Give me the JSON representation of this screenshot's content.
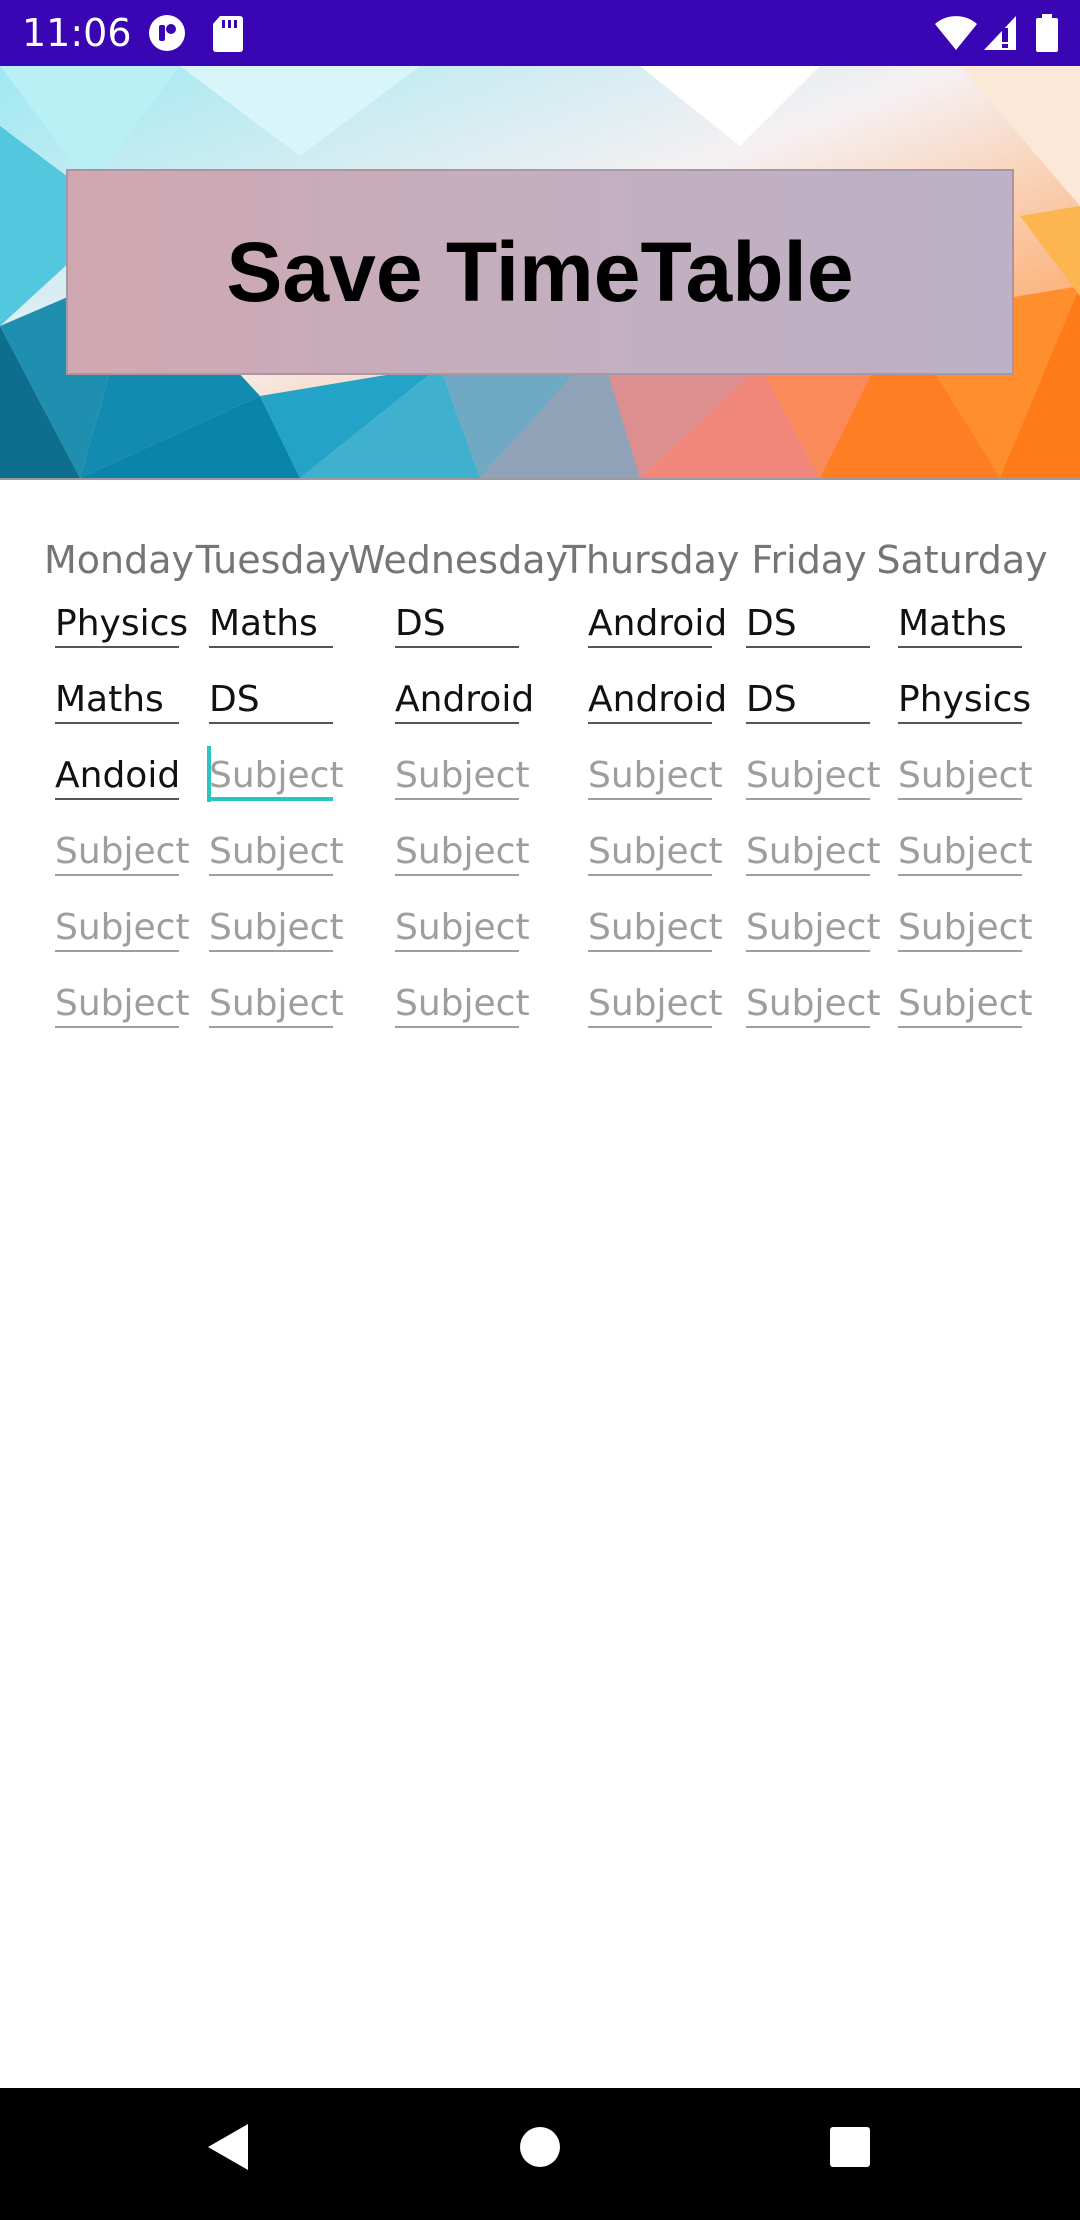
{
  "status_bar": {
    "time": "11:06",
    "icons": [
      "app-notification-icon",
      "sd-card-icon",
      "wifi-icon",
      "signal-icon",
      "battery-icon"
    ],
    "background_color": "#3a05b3"
  },
  "header": {
    "save_button_label": "Save TimeTable"
  },
  "timetable": {
    "days": [
      "Monday",
      "Tuesday",
      "Wednesday",
      "Thursday",
      "Friday",
      "Saturday"
    ],
    "placeholder": "Subject",
    "rows": [
      [
        "Physics",
        "Maths",
        "DS",
        "Android",
        "DS",
        "Maths"
      ],
      [
        "Maths",
        "DS",
        "Android",
        "Android",
        "DS",
        "Physics"
      ],
      [
        "Andoid",
        "",
        "",
        "",
        "",
        ""
      ],
      [
        "",
        "",
        "",
        "",
        "",
        ""
      ],
      [
        "",
        "",
        "",
        "",
        "",
        ""
      ],
      [
        "",
        "",
        "",
        "",
        "",
        ""
      ]
    ],
    "focused_cell": "row3-tuesday",
    "accent_color": "#2bc4c0"
  },
  "nav_bar": {
    "buttons": [
      "back-icon",
      "home-icon",
      "recents-icon"
    ]
  }
}
